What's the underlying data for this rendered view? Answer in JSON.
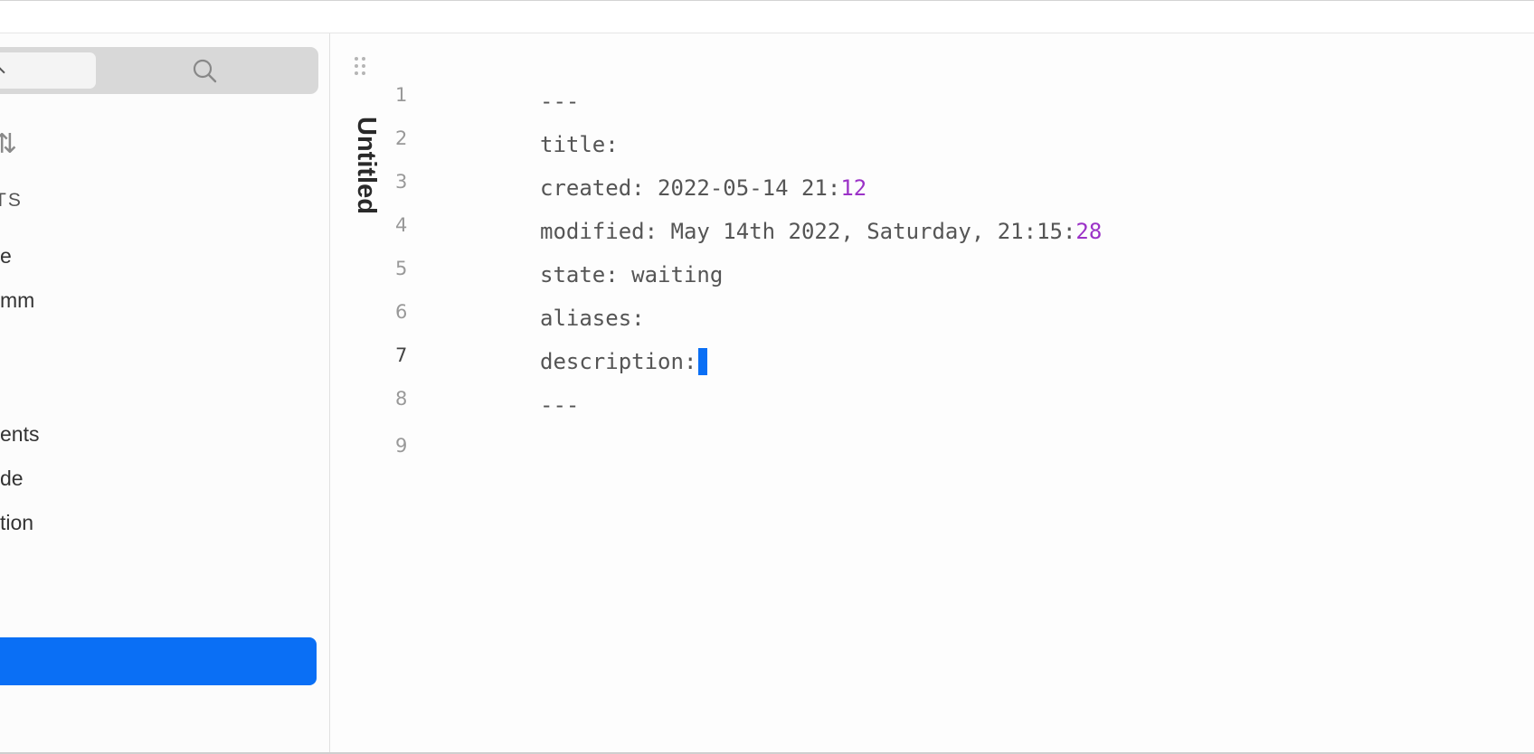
{
  "sidebar": {
    "heading": "TS",
    "items": [
      {
        "label": "e"
      },
      {
        "label": "mm"
      },
      {
        "label": "ents"
      },
      {
        "label": "de"
      },
      {
        "label": "tion"
      }
    ]
  },
  "editor": {
    "title": "Untitled",
    "lines": [
      {
        "number": "1",
        "text": "---",
        "highlight": ""
      },
      {
        "number": "2",
        "text": "title:",
        "highlight": ""
      },
      {
        "number": "3",
        "text": "created: 2022-05-14 21:",
        "highlight": "12"
      },
      {
        "number": "4",
        "text": "modified: May 14th 2022, Saturday, 21:15:",
        "highlight": "28"
      },
      {
        "number": "5",
        "text": "state: waiting",
        "highlight": ""
      },
      {
        "number": "6",
        "text": "aliases:",
        "highlight": ""
      },
      {
        "number": "7",
        "text": "description:",
        "highlight": ""
      },
      {
        "number": "8",
        "text": "---",
        "highlight": ""
      },
      {
        "number": "9",
        "text": "",
        "highlight": ""
      }
    ],
    "active_line": "7"
  },
  "colors": {
    "accent": "#0a6ff5",
    "number_highlight": "#9b32c7"
  },
  "icons": {
    "search": "search-icon",
    "sort": "sort-icon",
    "drag": "drag-handle-icon"
  }
}
